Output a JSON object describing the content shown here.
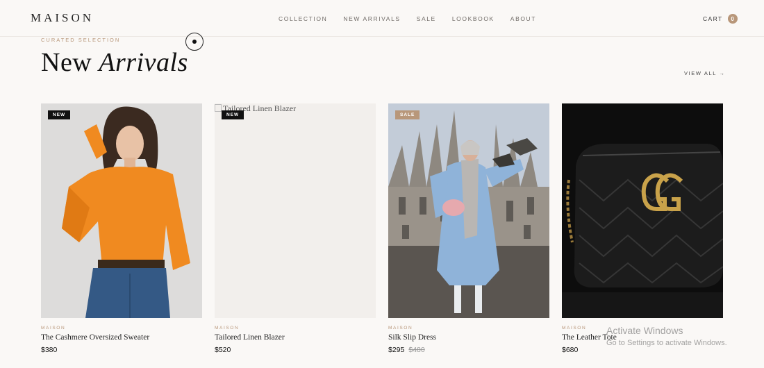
{
  "header": {
    "logo": "MAISON",
    "nav": [
      "COLLECTION",
      "NEW ARRIVALS",
      "SALE",
      "LOOKBOOK",
      "ABOUT"
    ],
    "cart_label": "CART",
    "cart_count": "0"
  },
  "hero": {
    "eyebrow": "CURATED SELECTION",
    "title_plain": "New",
    "title_italic": "Arrivals",
    "view_all": "VIEW ALL →"
  },
  "products": [
    {
      "badge": "NEW",
      "brand": "MAISON",
      "name": "The Cashmere Oversized Sweater",
      "price": "$380",
      "was": ""
    },
    {
      "badge": "NEW",
      "brand": "MAISON",
      "name": "Tailored Linen Blazer",
      "price": "$520",
      "was": "",
      "image_alt": "Tailored Linen Blazer"
    },
    {
      "badge": "SALE",
      "brand": "MAISON",
      "name": "Silk Slip Dress",
      "price": "$295",
      "was": "$480"
    },
    {
      "badge": "",
      "brand": "MAISON",
      "name": "The Leather Tote",
      "price": "$680",
      "was": ""
    }
  ],
  "overlay": {
    "line1": "Activate Windows",
    "line2": "Go to Settings to activate Windows."
  },
  "colors": {
    "accent": "#b8977a",
    "background": "#faf8f6",
    "text": "#1a1a1a"
  }
}
